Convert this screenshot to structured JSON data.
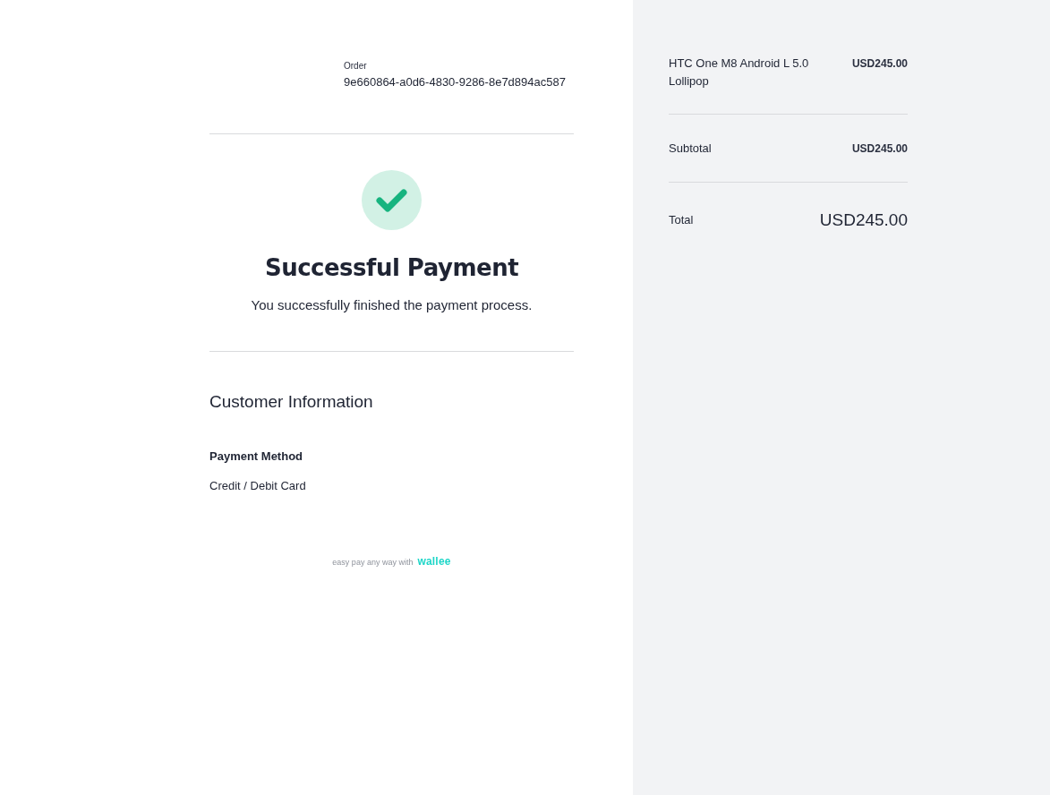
{
  "order": {
    "label": "Order",
    "id": "9e660864-a0d6-4830-9286-8e7d894ac587"
  },
  "status": {
    "kind": "success",
    "title": "Successful Payment",
    "message": "You successfully finished the payment process."
  },
  "customer_information": {
    "heading": "Customer Information",
    "fields": [
      {
        "label": "Payment Method",
        "value": "Credit / Debit Card"
      }
    ]
  },
  "footer": {
    "text": "easy pay any way with",
    "logo": "wallee"
  },
  "summary": {
    "items": [
      {
        "name": "HTC One M8 Android L 5.0 Lollipop",
        "price": "USD245.00"
      }
    ],
    "subtotal": {
      "label": "Subtotal",
      "value": "USD245.00"
    },
    "total": {
      "label": "Total",
      "value": "USD245.00"
    }
  }
}
